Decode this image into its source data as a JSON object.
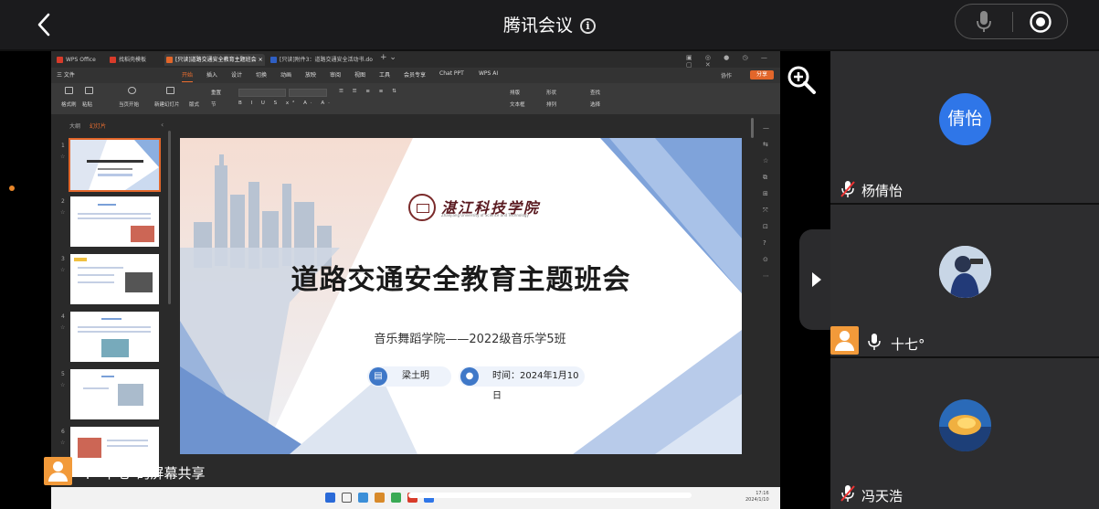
{
  "header": {
    "title": "腾讯会议"
  },
  "wps": {
    "tabs": [
      {
        "label": "WPS Office",
        "color": "#d83b2a"
      },
      {
        "label": "找稻壳模板",
        "color": "#d83b2a"
      },
      {
        "label": "[只读]道路交通安全教育主题班会 ×",
        "color": "#e2662a"
      },
      {
        "label": "[只读]附件3：道路交通安全活动书.do",
        "color": "#2f5fc4"
      }
    ],
    "menus": [
      "三 文件",
      "开始",
      "插入",
      "设计",
      "切换",
      "动画",
      "放映",
      "审阅",
      "视图",
      "工具",
      "会员专享",
      "Chat PPT",
      "WPS AI"
    ],
    "active_menu": "开始",
    "collab": "协作",
    "share": "分享",
    "ribbon_labels": [
      "格式刷",
      "粘贴",
      "当页开始",
      "新建幻灯片",
      "版式",
      "节",
      "重置",
      "排版",
      "文本框",
      "形状",
      "排列",
      "查找",
      "选择"
    ],
    "panel": {
      "outline": "大纲",
      "slides": "幻灯片"
    },
    "thumb_numbers": [
      "1",
      "2",
      "3",
      "4",
      "5",
      "6"
    ],
    "clock": {
      "time": "17:16",
      "date": "2024/1/10"
    }
  },
  "slide": {
    "school": "湛江科技学院",
    "school_en": "Zhanjiang University of Science and Technology",
    "title": "道路交通安全教育主题班会",
    "subtitle": "音乐舞蹈学院——2022级音乐学5班",
    "presenter": "梁土明",
    "time": "时间：2024年1月10日"
  },
  "share_label": "十七°的屏幕共享",
  "participants": [
    {
      "name": "杨倩怡",
      "avatar_text": "倩怡",
      "muted": true
    },
    {
      "name": "十七°",
      "muted": false
    },
    {
      "name": "冯天浩",
      "muted": true
    }
  ],
  "colors": {
    "accent_blue": "#2f76e8",
    "wps_orange": "#e2662a",
    "avatar_orange": "#f29a3a"
  }
}
